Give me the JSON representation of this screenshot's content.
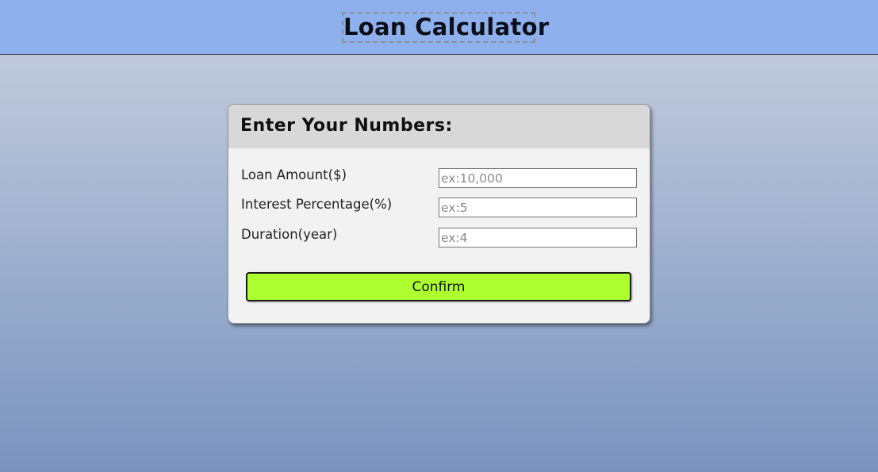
{
  "header": {
    "title": "Loan Calculator"
  },
  "form": {
    "title": "Enter Your Numbers:",
    "fields": [
      {
        "label": "Loan Amount($)",
        "placeholder": "ex:10,000",
        "value": ""
      },
      {
        "label": "Interest Percentage(%)",
        "placeholder": "ex:5",
        "value": ""
      },
      {
        "label": "Duration(year)",
        "placeholder": "ex:4",
        "value": ""
      }
    ],
    "confirm_label": "Confirm"
  },
  "colors": {
    "header_bar": "#8eb1ee",
    "confirm_button": "#adff2f",
    "card_background": "#f2f2f2",
    "card_header": "#d8d8d8"
  }
}
